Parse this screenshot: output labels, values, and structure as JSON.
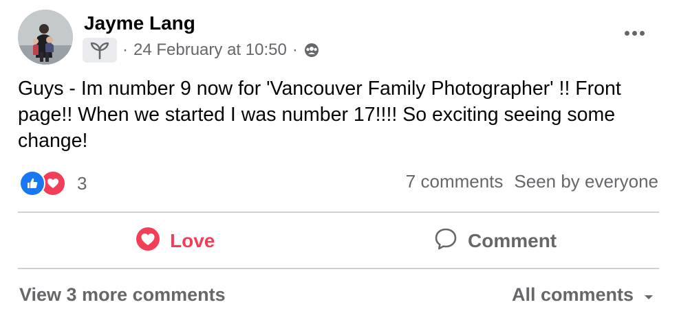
{
  "post": {
    "author": "Jayme Lang",
    "timestamp": "24 February at 10:50",
    "separator": "·",
    "audience_icon": "group-icon",
    "badge_icon": "sprout-icon",
    "more_icon": "more-options-icon",
    "text": "Guys - Im number 9 now for 'Vancouver Family Photographer' !! Front page!! When we started I was number 17!!!! So exciting seeing some change!"
  },
  "reactions": {
    "types": [
      "like",
      "love"
    ],
    "count": "3",
    "comments": "7 comments",
    "seen_by": "Seen by everyone"
  },
  "actions": {
    "love_label": "Love",
    "comment_label": "Comment"
  },
  "comments": {
    "view_more": "View 3 more comments",
    "filter_label": "All comments"
  },
  "colors": {
    "love": "#f33e58",
    "like": "#1877f2",
    "secondary_text": "#65676b",
    "divider": "#ced0d4"
  }
}
